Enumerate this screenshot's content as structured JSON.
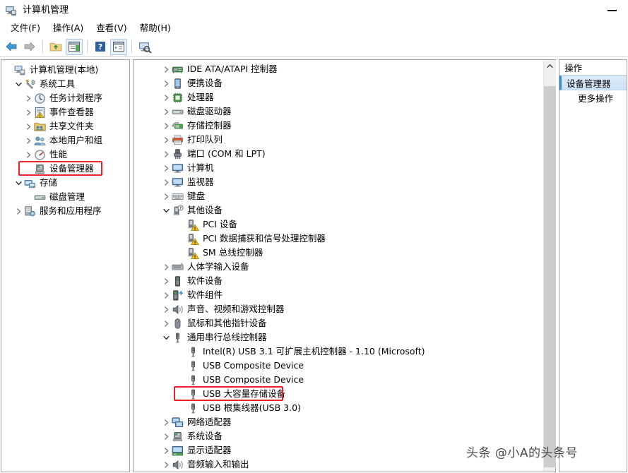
{
  "window": {
    "title": "计算机管理",
    "app_icon": "computer-management-icon",
    "minimize_label": "—"
  },
  "menubar": {
    "items": [
      {
        "label": "文件(F)",
        "name": "menu-file"
      },
      {
        "label": "操作(A)",
        "name": "menu-action"
      },
      {
        "label": "查看(V)",
        "name": "menu-view"
      },
      {
        "label": "帮助(H)",
        "name": "menu-help"
      }
    ]
  },
  "toolbar": {
    "buttons": [
      {
        "icon": "back-arrow-icon",
        "label": "后退"
      },
      {
        "icon": "forward-arrow-icon",
        "label": "前进"
      },
      {
        "icon": "up-folder-icon",
        "label": "向上"
      },
      {
        "icon": "show-console-tree-icon",
        "label": "显示/隐藏控制台树"
      },
      {
        "icon": "help-question-icon",
        "label": "帮助"
      },
      {
        "icon": "properties-icon",
        "label": "属性"
      },
      {
        "icon": "scan-hardware-icon",
        "label": "扫描检测硬件改动"
      }
    ]
  },
  "sidebar": {
    "items": [
      {
        "label": "计算机管理(本地)",
        "icon": "computer-management-icon",
        "indent": 0,
        "expander": "none"
      },
      {
        "label": "系统工具",
        "icon": "system-tools-icon",
        "indent": 1,
        "expander": "open"
      },
      {
        "label": "任务计划程序",
        "icon": "task-scheduler-icon",
        "indent": 2,
        "expander": "closed"
      },
      {
        "label": "事件查看器",
        "icon": "event-viewer-icon",
        "indent": 2,
        "expander": "closed"
      },
      {
        "label": "共享文件夹",
        "icon": "shared-folders-icon",
        "indent": 2,
        "expander": "closed"
      },
      {
        "label": "本地用户和组",
        "icon": "local-users-groups-icon",
        "indent": 2,
        "expander": "closed"
      },
      {
        "label": "性能",
        "icon": "performance-icon",
        "indent": 2,
        "expander": "closed"
      },
      {
        "label": "设备管理器",
        "icon": "device-manager-icon",
        "indent": 2,
        "expander": "none",
        "highlighted": true
      },
      {
        "label": "存储",
        "icon": "storage-icon",
        "indent": 1,
        "expander": "open"
      },
      {
        "label": "磁盘管理",
        "icon": "disk-management-icon",
        "indent": 2,
        "expander": "none"
      },
      {
        "label": "服务和应用程序",
        "icon": "services-apps-icon",
        "indent": 1,
        "expander": "closed"
      }
    ]
  },
  "device_tree": {
    "items": [
      {
        "label": "IDE ATA/ATAPI 控制器",
        "icon": "ide-controller-icon",
        "indent": 1,
        "expander": "closed"
      },
      {
        "label": "便携设备",
        "icon": "portable-device-icon",
        "indent": 1,
        "expander": "closed"
      },
      {
        "label": "处理器",
        "icon": "processor-icon",
        "indent": 1,
        "expander": "closed"
      },
      {
        "label": "磁盘驱动器",
        "icon": "disk-drive-icon",
        "indent": 1,
        "expander": "closed"
      },
      {
        "label": "存储控制器",
        "icon": "storage-controller-icon",
        "indent": 1,
        "expander": "closed"
      },
      {
        "label": "打印队列",
        "icon": "print-queue-icon",
        "indent": 1,
        "expander": "closed"
      },
      {
        "label": "端口 (COM 和 LPT)",
        "icon": "ports-icon",
        "indent": 1,
        "expander": "closed"
      },
      {
        "label": "计算机",
        "icon": "computer-icon",
        "indent": 1,
        "expander": "closed"
      },
      {
        "label": "监视器",
        "icon": "monitor-icon",
        "indent": 1,
        "expander": "closed"
      },
      {
        "label": "键盘",
        "icon": "keyboard-icon",
        "indent": 1,
        "expander": "closed"
      },
      {
        "label": "其他设备",
        "icon": "other-devices-icon",
        "indent": 1,
        "expander": "open"
      },
      {
        "label": "PCI 设备",
        "icon": "unknown-device-warning-icon",
        "indent": 2,
        "expander": "none"
      },
      {
        "label": "PCI 数据捕获和信号处理控制器",
        "icon": "unknown-device-warning-icon",
        "indent": 2,
        "expander": "none"
      },
      {
        "label": "SM 总线控制器",
        "icon": "unknown-device-warning-icon",
        "indent": 2,
        "expander": "none"
      },
      {
        "label": "人体学输入设备",
        "icon": "hid-icon",
        "indent": 1,
        "expander": "closed"
      },
      {
        "label": "软件设备",
        "icon": "software-device-icon",
        "indent": 1,
        "expander": "closed"
      },
      {
        "label": "软件组件",
        "icon": "software-component-icon",
        "indent": 1,
        "expander": "closed"
      },
      {
        "label": "声音、视频和游戏控制器",
        "icon": "sound-video-game-icon",
        "indent": 1,
        "expander": "closed"
      },
      {
        "label": "鼠标和其他指针设备",
        "icon": "mouse-icon",
        "indent": 1,
        "expander": "closed"
      },
      {
        "label": "通用串行总线控制器",
        "icon": "usb-controller-icon",
        "indent": 1,
        "expander": "open"
      },
      {
        "label": "Intel(R) USB 3.1 可扩展主机控制器 - 1.10 (Microsoft)",
        "icon": "usb-device-icon",
        "indent": 2,
        "expander": "none"
      },
      {
        "label": "USB Composite Device",
        "icon": "usb-device-icon",
        "indent": 2,
        "expander": "none"
      },
      {
        "label": "USB Composite Device",
        "icon": "usb-device-icon",
        "indent": 2,
        "expander": "none"
      },
      {
        "label": "USB 大容量存储设备",
        "icon": "usb-device-icon",
        "indent": 2,
        "expander": "none",
        "highlighted": true
      },
      {
        "label": "USB 根集线器(USB 3.0)",
        "icon": "usb-device-icon",
        "indent": 2,
        "expander": "none"
      },
      {
        "label": "网络适配器",
        "icon": "network-adapter-icon",
        "indent": 1,
        "expander": "closed"
      },
      {
        "label": "系统设备",
        "icon": "system-device-icon",
        "indent": 1,
        "expander": "closed"
      },
      {
        "label": "显示适配器",
        "icon": "display-adapter-icon",
        "indent": 1,
        "expander": "closed"
      },
      {
        "label": "音频输入和输出",
        "icon": "audio-io-icon",
        "indent": 1,
        "expander": "closed"
      }
    ],
    "scrollbar": {
      "position": "right",
      "up_arrow": "▲"
    }
  },
  "actions_panel": {
    "header": "操作",
    "selected_item": "设备管理器",
    "more_actions": "更多操作"
  },
  "annotations": {
    "highlight_color": "#e8232a",
    "boxes": [
      {
        "target": "sidebar-item-device-manager"
      },
      {
        "target": "device-usb-mass-storage"
      }
    ]
  },
  "watermark": {
    "text": "头条 @小A的头条号"
  }
}
